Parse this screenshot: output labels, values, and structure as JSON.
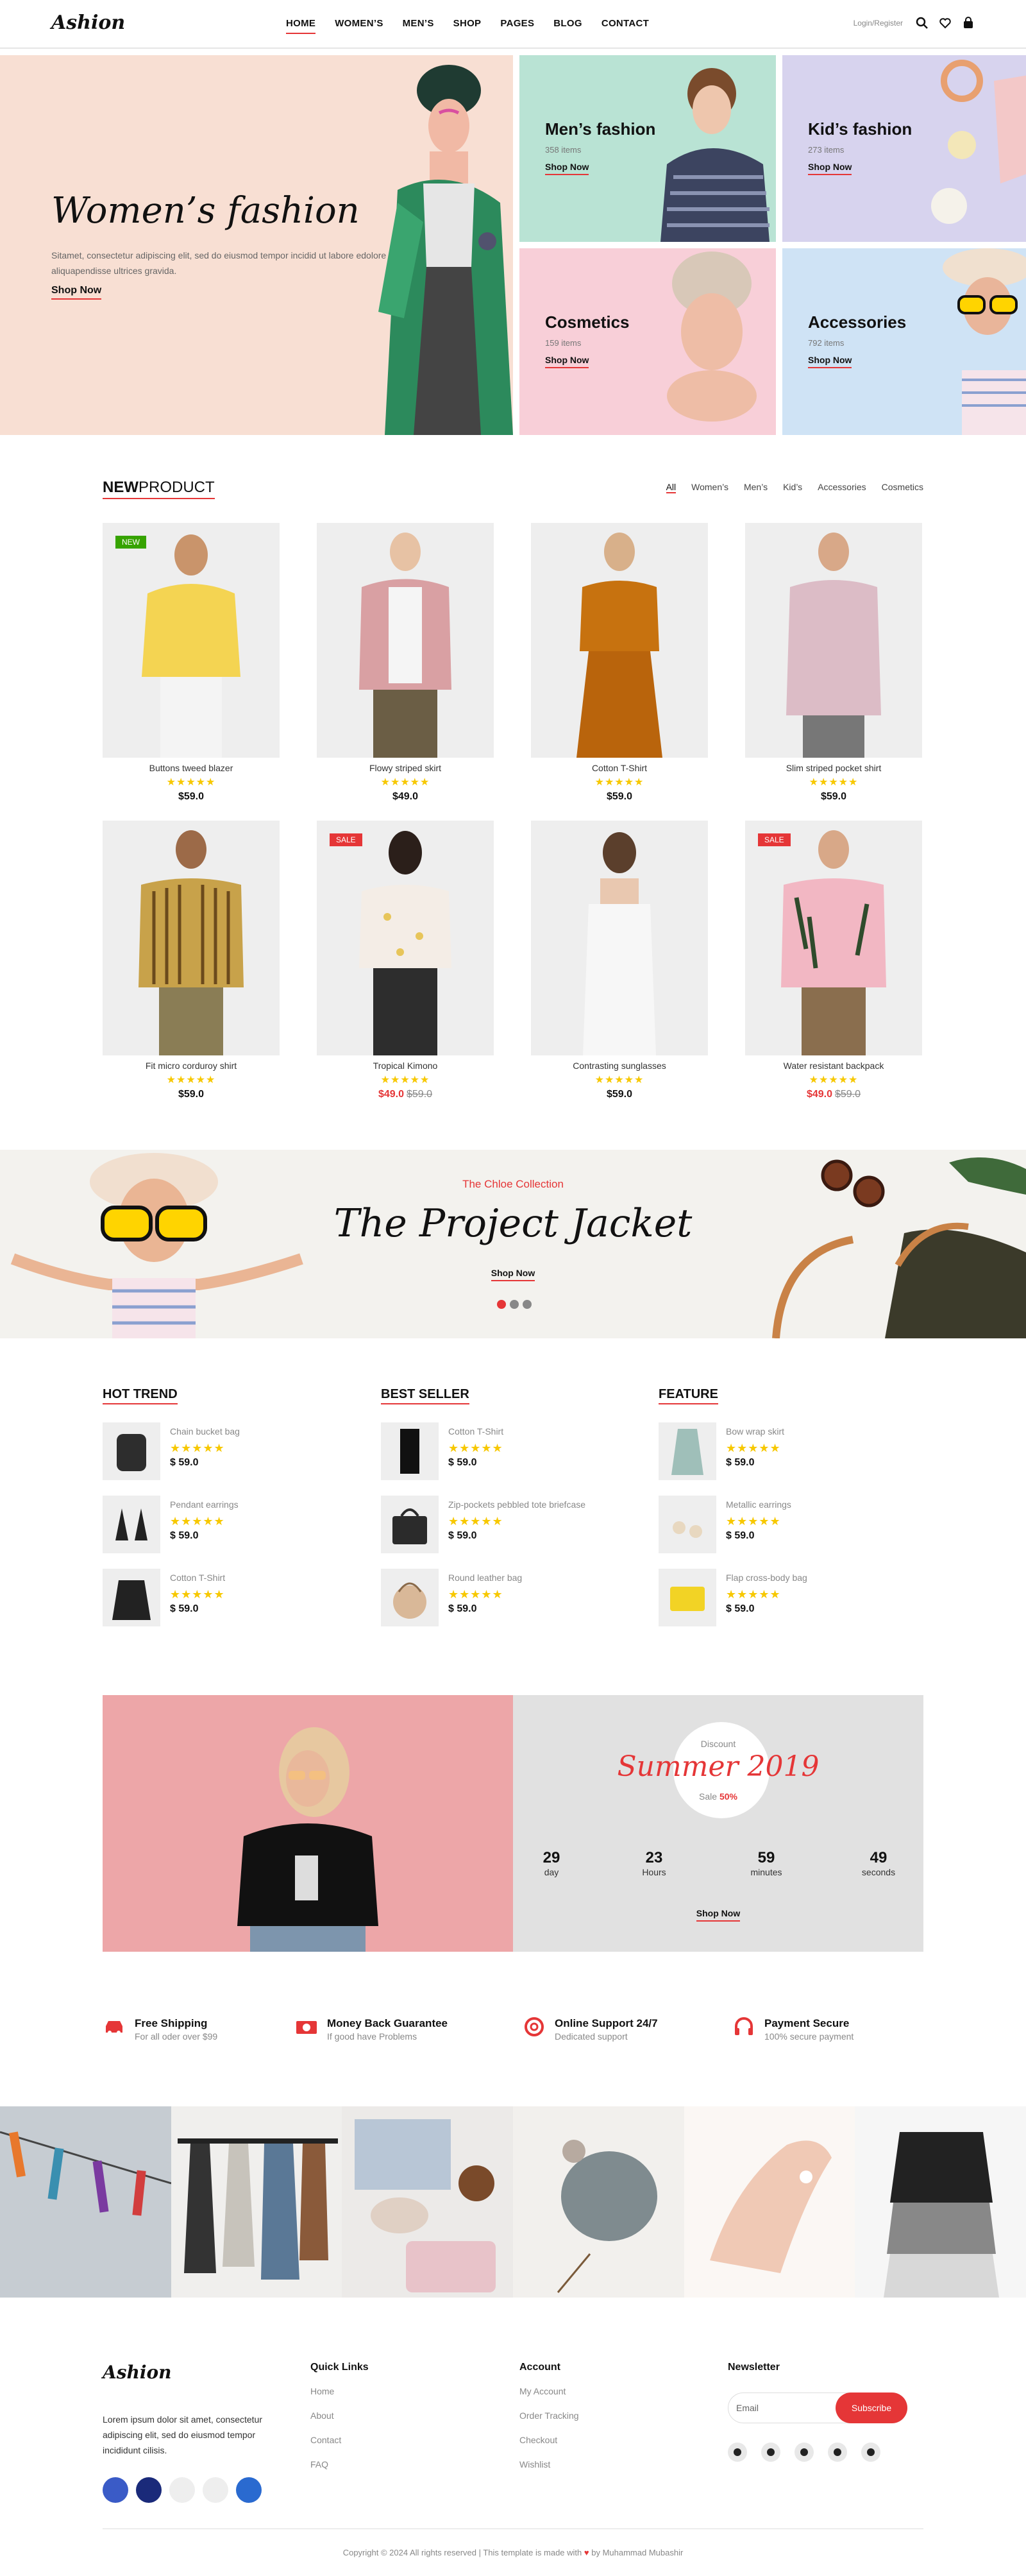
{
  "header": {
    "logo": "Ashion",
    "nav": [
      "HOME",
      "WOMEN’S",
      "MEN’S",
      "SHOP",
      "PAGES",
      "BLOG",
      "CONTACT"
    ],
    "login": "Login/Register"
  },
  "hero": {
    "title": "Women’s fashion",
    "text": "Sitamet, consectetur adipiscing elit, sed do eiusmod tempor incidid ut labore edolore magna aliquapendisse ultrices gravida.",
    "shop": "Shop Now",
    "tiles": [
      {
        "title": "Men’s fashion",
        "count": "358 items",
        "shop": "Shop Now",
        "bg": "#b9e3d4"
      },
      {
        "title": "Kid’s fashion",
        "count": "273 items",
        "shop": "Shop Now",
        "bg": "#d7d3ee"
      },
      {
        "title": "Cosmetics",
        "count": "159 items",
        "shop": "Shop Now",
        "bg": "#f8cfd8"
      },
      {
        "title": "Accessories",
        "count": "792 items",
        "shop": "Shop Now",
        "bg": "#cfe3f5"
      }
    ]
  },
  "new_product": {
    "title_bold": "NEW",
    "title_rest": "PRODUCT",
    "filters": [
      "All",
      "Women’s",
      "Men’s",
      "Kid’s",
      "Accessories",
      "Cosmetics"
    ],
    "stars": "★★★★★",
    "products": [
      {
        "name": "Buttons tweed blazer",
        "price": "$59.0",
        "badge": "NEW",
        "old": ""
      },
      {
        "name": "Flowy striped skirt",
        "price": "$49.0",
        "badge": "",
        "old": ""
      },
      {
        "name": "Cotton T-Shirt",
        "price": "$59.0",
        "badge": "",
        "old": ""
      },
      {
        "name": "Slim striped pocket shirt",
        "price": "$59.0",
        "badge": "",
        "old": ""
      },
      {
        "name": "Fit micro corduroy shirt",
        "price": "$59.0",
        "badge": "",
        "old": ""
      },
      {
        "name": "Tropical Kimono",
        "price": "$49.0",
        "badge": "SALE",
        "old": "$59.0"
      },
      {
        "name": "Contrasting sunglasses",
        "price": "$59.0",
        "badge": "",
        "old": ""
      },
      {
        "name": "Water resistant backpack",
        "price": "$49.0",
        "badge": "SALE",
        "old": "$59.0"
      }
    ]
  },
  "banner": {
    "collection": "The Chloe Collection",
    "title": "The Project Jacket",
    "shop": "Shop Now"
  },
  "trends": [
    {
      "title": "HOT TREND",
      "items": [
        {
          "name": "Chain bucket bag",
          "price": "$ 59.0"
        },
        {
          "name": "Pendant earrings",
          "price": "$ 59.0"
        },
        {
          "name": "Cotton T-Shirt",
          "price": "$ 59.0"
        }
      ]
    },
    {
      "title": "BEST SELLER",
      "items": [
        {
          "name": "Cotton T-Shirt",
          "price": "$ 59.0"
        },
        {
          "name": "Zip-pockets pebbled tote briefcase",
          "price": "$ 59.0"
        },
        {
          "name": "Round leather bag",
          "price": "$ 59.0"
        }
      ]
    },
    {
      "title": "FEATURE",
      "items": [
        {
          "name": "Bow wrap skirt",
          "price": "$ 59.0"
        },
        {
          "name": "Metallic earrings",
          "price": "$ 59.0"
        },
        {
          "name": "Flap cross-body bag",
          "price": "$ 59.0"
        }
      ]
    }
  ],
  "discount": {
    "label": "Discount",
    "title": "Summer 2019",
    "sale": "Sale",
    "percent": "50%",
    "countdown": [
      {
        "n": "29",
        "l": "day"
      },
      {
        "n": "23",
        "l": "Hours"
      },
      {
        "n": "59",
        "l": "minutes"
      },
      {
        "n": "49",
        "l": "seconds"
      }
    ],
    "shop": "Shop Now"
  },
  "services": [
    {
      "title": "Free Shipping",
      "sub": "For all oder over $99"
    },
    {
      "title": "Money Back Guarantee",
      "sub": "If good have Problems"
    },
    {
      "title": "Online Support 24/7",
      "sub": "Dedicated support"
    },
    {
      "title": "Payment Secure",
      "sub": "100% secure payment"
    }
  ],
  "footer": {
    "logo": "Ashion",
    "desc": "Lorem ipsum dolor sit amet, consectetur adipiscing elit, sed do eiusmod tempor incididunt cilisis.",
    "quick_title": "Quick Links",
    "quick": [
      "Home",
      "About",
      "Contact",
      "FAQ"
    ],
    "account_title": "Account",
    "account": [
      "My Account",
      "Order Tracking",
      "Checkout",
      "Wishlist"
    ],
    "newsletter_title": "Newsletter",
    "email_placeholder": "Email",
    "subscribe": "Subscribe",
    "copyright_a": "Copyright © 2024 All rights reserved | This template is made with",
    "copyright_b": "by Muhammad Mubashir"
  },
  "colors": {
    "accent": "#e53637",
    "star": "#f7c800"
  }
}
